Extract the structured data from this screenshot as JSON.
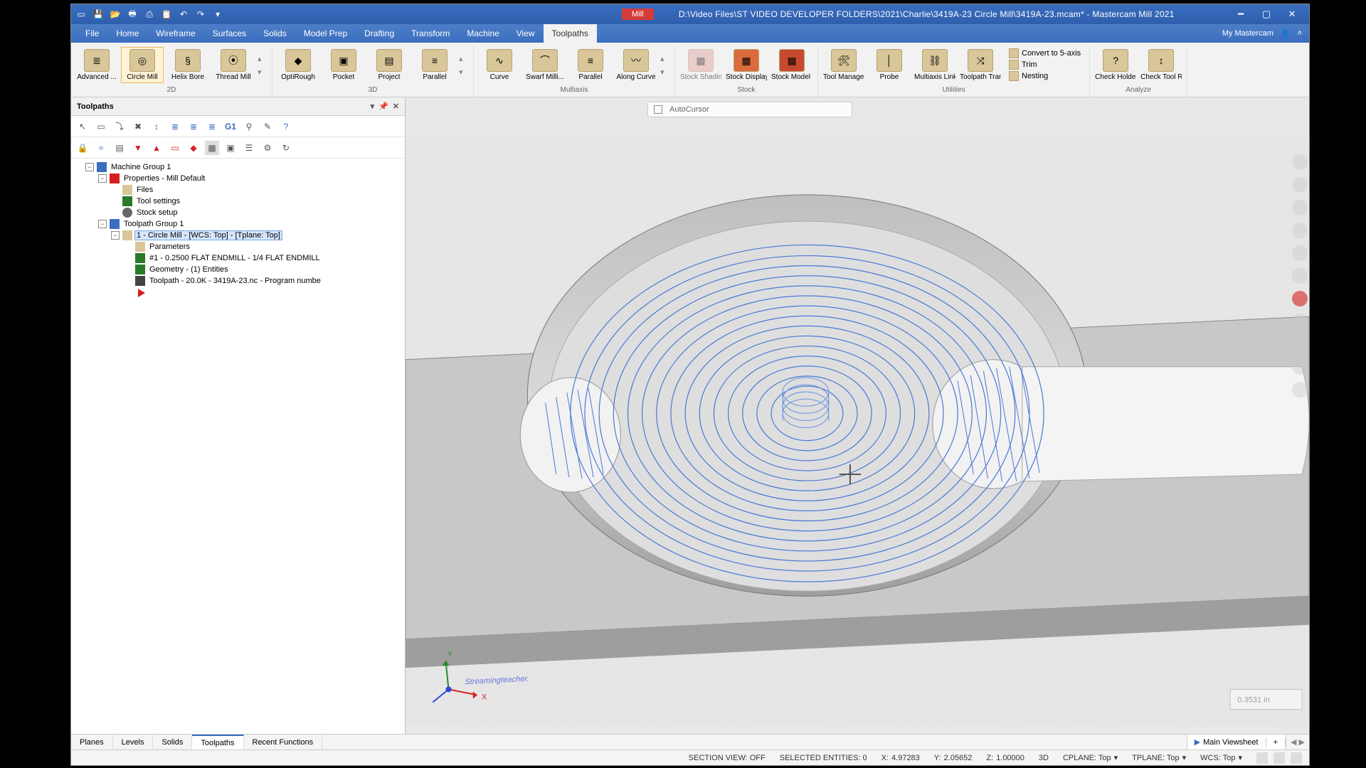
{
  "titlebar": {
    "tag": "Mill",
    "path": "D:\\Video Files\\ST VIDEO DEVELOPER FOLDERS\\2021\\Charlie\\3419A-23 Circle Mill\\3419A-23.mcam* - Mastercam Mill 2021"
  },
  "menu": {
    "items": [
      "File",
      "Home",
      "Wireframe",
      "Surfaces",
      "Solids",
      "Model Prep",
      "Drafting",
      "Transform",
      "Machine",
      "View",
      "Toolpaths"
    ],
    "active": 10,
    "account": "My Mastercam"
  },
  "ribbon": {
    "g2d": {
      "name": "2D",
      "items": [
        "Advanced ...",
        "Circle Mill",
        "Helix Bore",
        "Thread Mill"
      ],
      "sel": 1
    },
    "g3d": {
      "name": "3D",
      "items": [
        "OptiRough",
        "Pocket",
        "Project",
        "Parallel"
      ]
    },
    "gmulti": {
      "name": "Multiaxis",
      "items": [
        "Curve",
        "Swarf Milli...",
        "Parallel",
        "Along Curve"
      ]
    },
    "gstock": {
      "name": "Stock",
      "items": [
        "Stock Shading",
        "Stock Display",
        "Stock Model ▾"
      ]
    },
    "gutil": {
      "name": "Utilities",
      "big": [
        "Tool Manager",
        "Probe",
        "Multiaxis Linking",
        "Toolpath Transform"
      ],
      "small": [
        "Convert to 5-axis",
        "Trim",
        "Nesting"
      ]
    },
    "ganalyze": {
      "name": "Analyze",
      "items": [
        "Check Holder",
        "Check Tool Reach"
      ]
    }
  },
  "panel": {
    "title": "Toolpaths",
    "tree": {
      "root": "Machine Group 1",
      "props": "Properties - Mill Default",
      "files": "Files",
      "tset": "Tool settings",
      "stock": "Stock setup",
      "tgroup": "Toolpath Group 1",
      "op": "1 - Circle Mill - [WCS: Top] - [Tplane: Top]",
      "params": "Parameters",
      "tool": "#1 - 0.2500 FLAT ENDMILL -  1/4 FLAT ENDMILL",
      "geom": "Geometry - (1) Entities",
      "tpath": "Toolpath - 20.0K - 3419A-23.nc - Program numbe"
    }
  },
  "viewport": {
    "autocursor": "AutoCursor",
    "watermark": "Streamingteacher.",
    "axes": {
      "x": "X",
      "y": "Y"
    },
    "scale": "0.3531 in"
  },
  "tabs": {
    "lower": [
      "Planes",
      "Levels",
      "Solids",
      "Toolpaths",
      "Recent Functions"
    ],
    "lower_active": 3,
    "viewsheet": "Main Viewsheet"
  },
  "status": {
    "section": "SECTION VIEW: OFF",
    "sel": "SELECTED ENTITIES: 0",
    "x_label": "X:",
    "x": "4.97283",
    "y_label": "Y:",
    "y": "2.05652",
    "z_label": "Z:",
    "z": "1.00000",
    "mode": "3D",
    "cplane": "CPLANE: Top",
    "tplane": "TPLANE: Top",
    "wcs": "WCS: Top"
  }
}
